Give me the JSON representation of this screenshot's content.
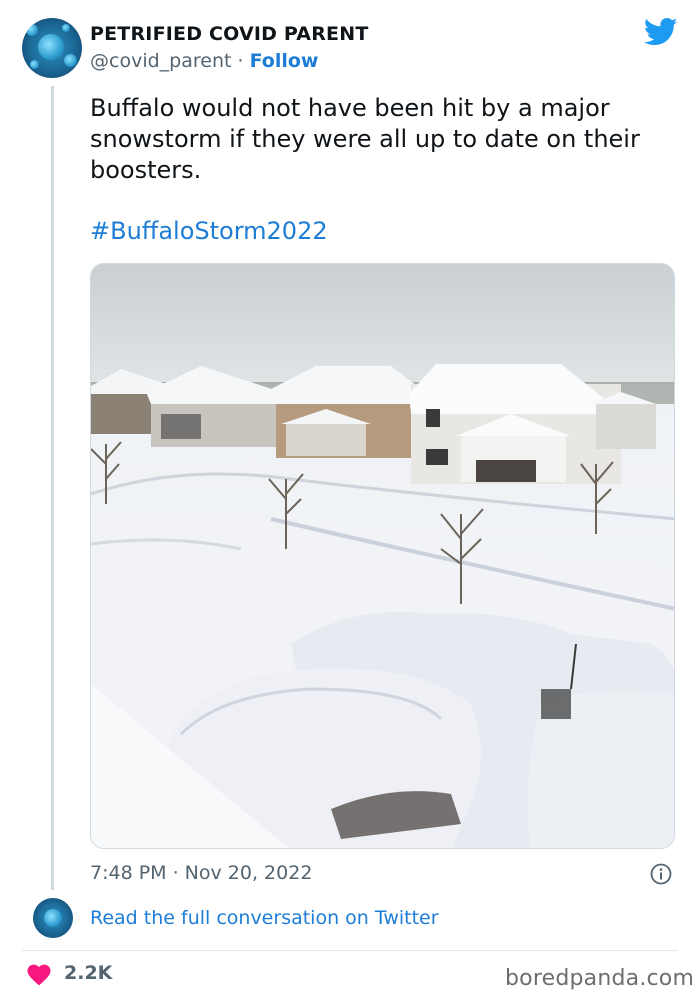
{
  "author": {
    "display_name": "PETRIFIED COVID PARENT",
    "handle": "@covid_parent",
    "separator": "·",
    "follow_label": "Follow",
    "avatar_icon": "virus-avatar-icon"
  },
  "brand": {
    "logo_icon": "twitter-bird-icon",
    "accent_color": "#1d9bf0",
    "link_color": "#1d7dd6"
  },
  "tweet": {
    "text": "Buffalo would not have been hit by a major snowstorm if they were all up to date on their boosters.",
    "hashtag": "#BuffaloStorm2022",
    "image_icon": "snowy-neighborhood-photo",
    "timestamp": "7:48 PM · Nov 20, 2022"
  },
  "footer": {
    "read_conversation": "Read the full conversation on Twitter",
    "likes": "2.2K",
    "heart_color": "#f91880",
    "watermark": "boredpanda.com"
  }
}
